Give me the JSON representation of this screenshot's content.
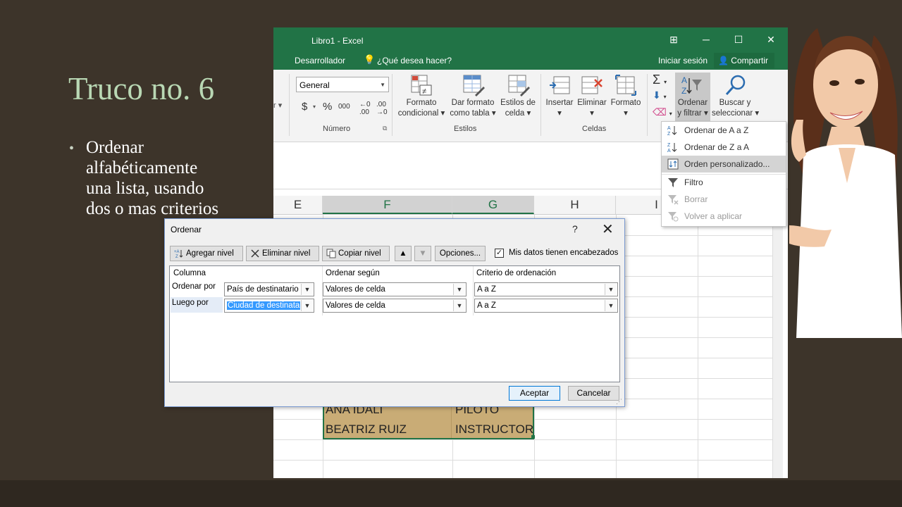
{
  "slide": {
    "title": "Truco no. 6",
    "bullet_text": "Ordenar alfabéticamente una lista, usando dos o mas criterios"
  },
  "excel": {
    "window_title": "Libro1 - Excel",
    "menu": {
      "developer": "Desarrollador",
      "tell_me": "¿Qué desea hacer?",
      "sign_in": "Iniciar sesión",
      "share": "Compartir"
    },
    "ribbon": {
      "number_format": "General",
      "currency": "$",
      "percent": "%",
      "thousands": "000",
      "groups": {
        "numero": "Número",
        "estilos": "Estilos",
        "celdas": "Celdas"
      },
      "buttons": {
        "formato_condicional": [
          "Formato",
          "condicional"
        ],
        "dar_formato_tabla": [
          "Dar formato",
          "como tabla"
        ],
        "estilos_celda": [
          "Estilos de",
          "celda"
        ],
        "insertar": "Insertar",
        "eliminar": "Eliminar",
        "formato": "Formato",
        "ordenar_filtrar": [
          "Ordenar",
          "y filtrar"
        ],
        "buscar_seleccionar": [
          "Buscar y",
          "seleccionar"
        ]
      }
    },
    "columns": [
      "E",
      "F",
      "G",
      "H",
      "I"
    ],
    "selected_columns": [
      "F",
      "G"
    ],
    "cells": [
      {
        "name": "ANA IDALI",
        "role": "PILOTO"
      },
      {
        "name": "BEATRIZ RUIZ",
        "role": "INSTRUCTOR"
      }
    ],
    "colors": {
      "excel_green": "#217346",
      "cell_fill": "#c9ac76"
    }
  },
  "sort_menu": {
    "items": [
      {
        "label": "Ordenar de A a Z",
        "icon": "sort-a-z-icon",
        "state": "normal"
      },
      {
        "label": "Ordenar de Z a A",
        "icon": "sort-z-a-icon",
        "state": "normal"
      },
      {
        "label": "Orden personalizado...",
        "icon": "custom-sort-icon",
        "state": "highlighted"
      },
      {
        "label": "Filtro",
        "icon": "filter-icon",
        "state": "normal"
      },
      {
        "label": "Borrar",
        "icon": "clear-filter-icon",
        "state": "disabled"
      },
      {
        "label": "Volver a aplicar",
        "icon": "reapply-icon",
        "state": "disabled"
      }
    ]
  },
  "dialog": {
    "title": "Ordenar",
    "help": "?",
    "close": "✕",
    "toolbar": {
      "add_level": "Agregar nivel",
      "delete_level": "Eliminar nivel",
      "copy_level": "Copiar nivel",
      "options": "Opciones...",
      "has_headers_label": "Mis datos tienen encabezados",
      "has_headers_checked": true
    },
    "headers": {
      "column": "Columna",
      "sort_on": "Ordenar según",
      "order": "Criterio de ordenación"
    },
    "rows": [
      {
        "label": "Ordenar por",
        "column": "País de destinatario",
        "sort_on": "Valores de celda",
        "order": "A a Z"
      },
      {
        "label": "Luego por",
        "column": "Ciudad de destinata",
        "sort_on": "Valores de celda",
        "order": "A a Z"
      }
    ],
    "ok": "Aceptar",
    "cancel": "Cancelar"
  }
}
